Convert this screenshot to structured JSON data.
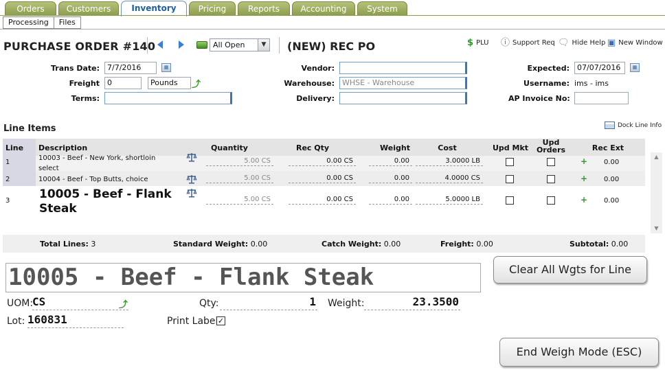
{
  "main_tabs": [
    "Orders",
    "Customers",
    "Inventory",
    "Pricing",
    "Reports",
    "Accounting",
    "System"
  ],
  "active_tab": "Inventory",
  "sub_tabs": [
    "Processing",
    "Files"
  ],
  "header": {
    "po_title": "PURCHASE ORDER #140",
    "filter_value": "All Open",
    "rec_title": "(NEW) REC PO",
    "tools": {
      "plu": "PLU",
      "support": "Support Req",
      "help": "Hide Help",
      "new_window": "New Window"
    }
  },
  "form": {
    "trans_date_label": "Trans Date:",
    "trans_date": "7/7/2016",
    "freight_label": "Freight",
    "freight_value": "0",
    "freight_unit": "Pounds",
    "terms_label": "Terms:",
    "terms_value": "",
    "vendor_label": "Vendor:",
    "vendor_value": "",
    "warehouse_label": "Warehouse:",
    "warehouse_value": "WHSE - Warehouse",
    "delivery_label": "Delivery:",
    "delivery_value": "",
    "expected_label": "Expected:",
    "expected_value": "07/07/2016",
    "username_label": "Username:",
    "username_value": "ims - ims",
    "ap_invoice_label": "AP Invoice No:",
    "ap_invoice_value": ""
  },
  "line_items": {
    "title": "Line Items",
    "dock_label": "Dock Line Info",
    "headers": {
      "line": "Line",
      "description": "Description",
      "quantity": "Quantity",
      "rec_qty": "Rec Qty",
      "weight": "Weight",
      "cost": "Cost",
      "upd_mkt": "Upd Mkt",
      "upd_orders": "Upd\nOrders",
      "rec_ext": "Rec Ext"
    },
    "rows": [
      {
        "line": "1",
        "desc": "10003 - Beef - New York, shortloin select",
        "qty": "5.00 CS",
        "rec_qty": "0.00 CS",
        "weight": "0.00",
        "cost": "3.0000 LB",
        "rec_ext": "0.00"
      },
      {
        "line": "2",
        "desc": "10004 - Beef - Top Butts, choice",
        "qty": "5.00 CS",
        "rec_qty": "0.00 CS",
        "weight": "0.00",
        "cost": "4.0000 CS",
        "rec_ext": "0.00"
      },
      {
        "line": "3",
        "desc": "10005 - Beef - Flank Steak",
        "qty": "5.00 CS",
        "rec_qty": "0.00 CS",
        "weight": "0.00",
        "cost": "5.0000 LB",
        "rec_ext": "0.00"
      }
    ]
  },
  "totals": {
    "total_lines_label": "Total Lines:",
    "total_lines": "3",
    "std_weight_label": "Standard Weight:",
    "std_weight": "0.00",
    "catch_weight_label": "Catch Weight:",
    "catch_weight": "0.00",
    "freight_label": "Freight:",
    "freight": "0.00",
    "subtotal_label": "Subtotal:",
    "subtotal": "0.00"
  },
  "weigh": {
    "description": "10005 - Beef - Flank Steak",
    "clear_button": "Clear All Wgts for Line",
    "uom_label": "UOM:",
    "uom_value": "CS",
    "qty_label": "Qty:",
    "qty_value": "1",
    "weight_label": "Weight:",
    "weight_value": "23.3500",
    "lot_label": "Lot:",
    "lot_value": "160831",
    "print_label": "Print Label:",
    "end_button": "End Weigh Mode (ESC)"
  }
}
